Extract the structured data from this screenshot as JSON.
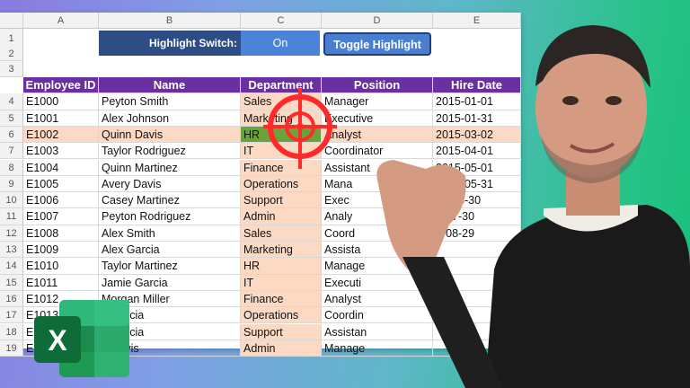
{
  "columns": [
    "A",
    "B",
    "C",
    "D",
    "E"
  ],
  "control": {
    "switch_label": "Highlight Switch:",
    "switch_value": "On",
    "toggle_button": "Toggle Highlight"
  },
  "headers": [
    "Employee ID",
    "Name",
    "Department",
    "Position",
    "Hire Date"
  ],
  "rows": [
    [
      "E1000",
      "Peyton Smith",
      "Sales",
      "Manager",
      "2015-01-01"
    ],
    [
      "E1001",
      "Alex Johnson",
      "Marketing",
      "Executive",
      "2015-01-31"
    ],
    [
      "E1002",
      "Quinn Davis",
      "HR",
      "Analyst",
      "2015-03-02"
    ],
    [
      "E1003",
      "Taylor Rodriguez",
      "IT",
      "Coordinator",
      "2015-04-01"
    ],
    [
      "E1004",
      "Quinn Martinez",
      "Finance",
      "Assistant",
      "2015-05-01"
    ],
    [
      "E1005",
      "Avery Davis",
      "Operations",
      "Mana",
      "2015-05-31"
    ],
    [
      "E1006",
      "Casey Martinez",
      "Support",
      "Exec",
      "20-06-30"
    ],
    [
      "E1007",
      "Peyton Rodriguez",
      "Admin",
      "Analy",
      "5-07-30"
    ],
    [
      "E1008",
      "Alex Smith",
      "Sales",
      "Coord",
      "5-08-29"
    ],
    [
      "E1009",
      "Alex Garcia",
      "Marketing",
      "Assista",
      ""
    ],
    [
      "E1010",
      "Taylor Martinez",
      "HR",
      "Manage",
      ""
    ],
    [
      "E1011",
      "Jamie Garcia",
      "IT",
      "Executi",
      ""
    ],
    [
      "E1012",
      "Morgan Miller",
      "Finance",
      "Analyst",
      ""
    ],
    [
      "E1013",
      "n Garcia",
      "Operations",
      "Coordin",
      ""
    ],
    [
      "E1",
      "n Garcia",
      "Support",
      "Assistan",
      ""
    ],
    [
      "E1",
      "n Davis",
      "Admin",
      "Manage",
      ""
    ]
  ],
  "row_numbers": [
    "1",
    "2",
    "3",
    "4",
    "5",
    "6",
    "7",
    "8",
    "9",
    "10",
    "11",
    "12",
    "13",
    "14",
    "15",
    "16",
    "17",
    "18",
    "19"
  ],
  "highlighted_row": "6",
  "accent_colors": {
    "header": "#6a2fa0",
    "highlight": "#fbd9c3",
    "switch": "#2e4d84",
    "target": "#ff2a2a"
  }
}
